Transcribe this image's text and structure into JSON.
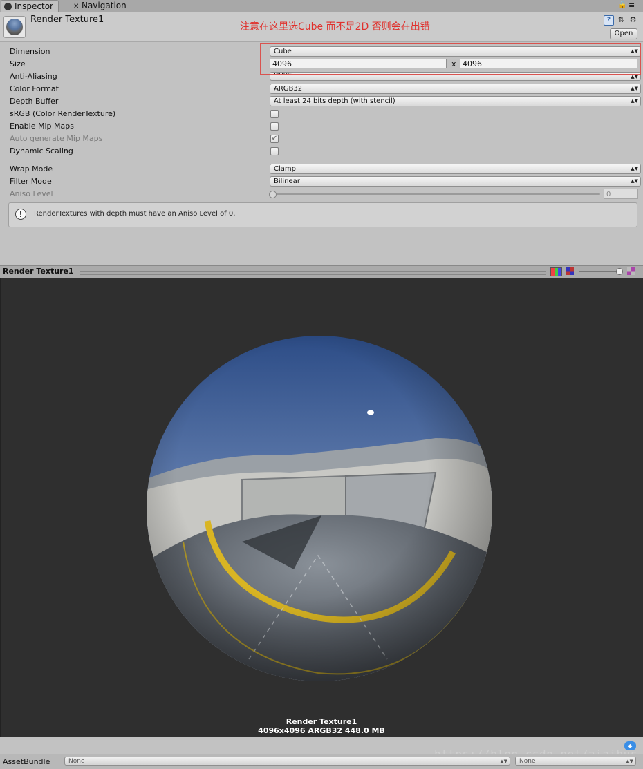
{
  "tabs": [
    {
      "label": "Inspector",
      "icon": "info-icon",
      "active": true
    },
    {
      "label": "Navigation",
      "icon": "navigation-icon",
      "active": false
    }
  ],
  "header": {
    "asset_title": "Render Texture1",
    "annotation": "注意在这里选Cube 而不是2D 否则会在出错",
    "open_label": "Open",
    "annotation_color": "#e0302c"
  },
  "properties": {
    "dimension": {
      "label": "Dimension",
      "value": "Cube"
    },
    "size": {
      "label": "Size",
      "width": "4096",
      "x": "x",
      "height": "4096"
    },
    "anti_aliasing": {
      "label": "Anti-Aliasing",
      "value": "None"
    },
    "color_format": {
      "label": "Color Format",
      "value": "ARGB32"
    },
    "depth_buffer": {
      "label": "Depth Buffer",
      "value": "At least 24 bits depth (with stencil)"
    },
    "srgb": {
      "label": "sRGB (Color RenderTexture)",
      "checked": false
    },
    "enable_mip_maps": {
      "label": "Enable Mip Maps",
      "checked": false
    },
    "auto_generate_mip_maps": {
      "label": "Auto generate Mip Maps",
      "checked": true,
      "disabled": true
    },
    "dynamic_scaling": {
      "label": "Dynamic Scaling",
      "checked": false
    },
    "wrap_mode": {
      "label": "Wrap Mode",
      "value": "Clamp"
    },
    "filter_mode": {
      "label": "Filter Mode",
      "value": "Bilinear"
    },
    "aniso_level": {
      "label": "Aniso Level",
      "value": "0",
      "slider_fraction": 0
    }
  },
  "help_box": {
    "text": "RenderTextures with depth must have an Aniso Level of 0."
  },
  "preview": {
    "title": "Render Texture1",
    "info_name": "Render Texture1",
    "info_details": "4096x4096  ARGB32  448.0 MB"
  },
  "asset_bundle": {
    "label": "AssetBundle",
    "name_value": "None",
    "variant_value": "None"
  },
  "watermark": "https://blog.csdn.net/aiaihus"
}
